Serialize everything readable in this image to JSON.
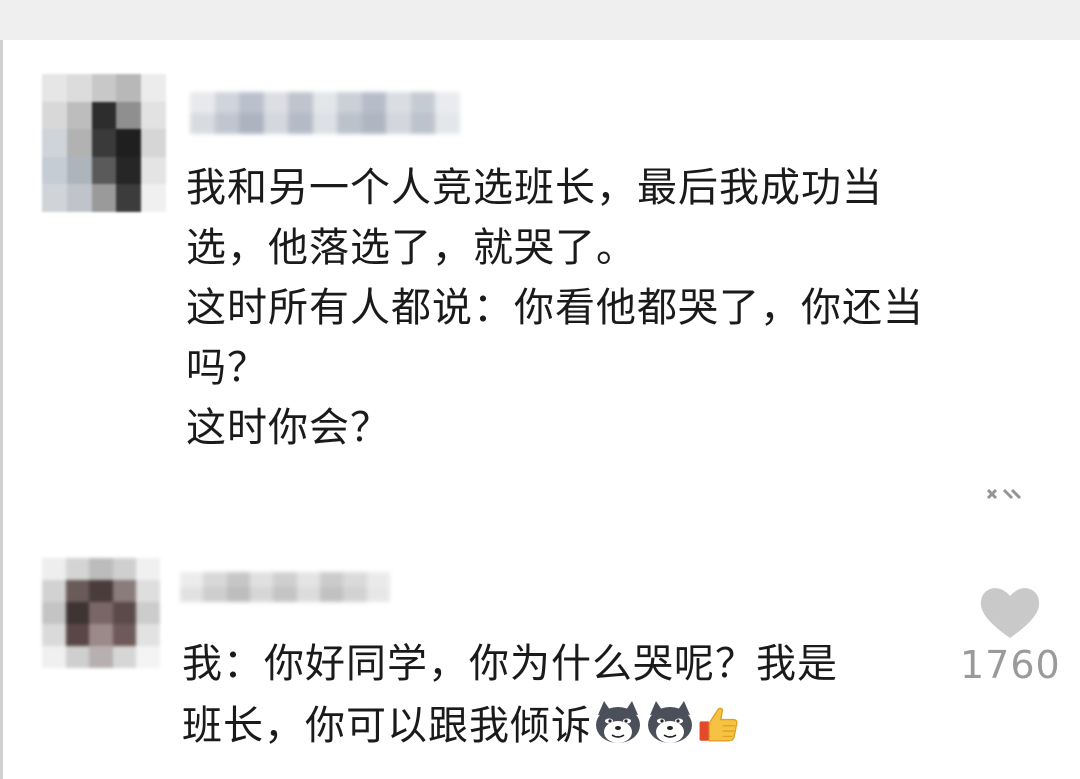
{
  "post": {
    "lines": [
      "我和另一个人竞选班长，最后我成功当",
      "选，他落选了，就哭了。",
      "这时所有人都说：你看他都哭了，你还当",
      "吗？",
      "这时你会？"
    ]
  },
  "reply": {
    "line1": "我：你好同学，你为什么哭呢？我是",
    "line2": "班长，你可以跟我倾诉",
    "emojis": [
      "doge-icon",
      "doge-icon",
      "thumbs-up-icon"
    ],
    "like_count": "1760"
  },
  "colors": {
    "text": "#1a1a1a",
    "muted": "#9a9a9a",
    "like_icon": "#c9c9c9",
    "background": "#ffffff"
  }
}
